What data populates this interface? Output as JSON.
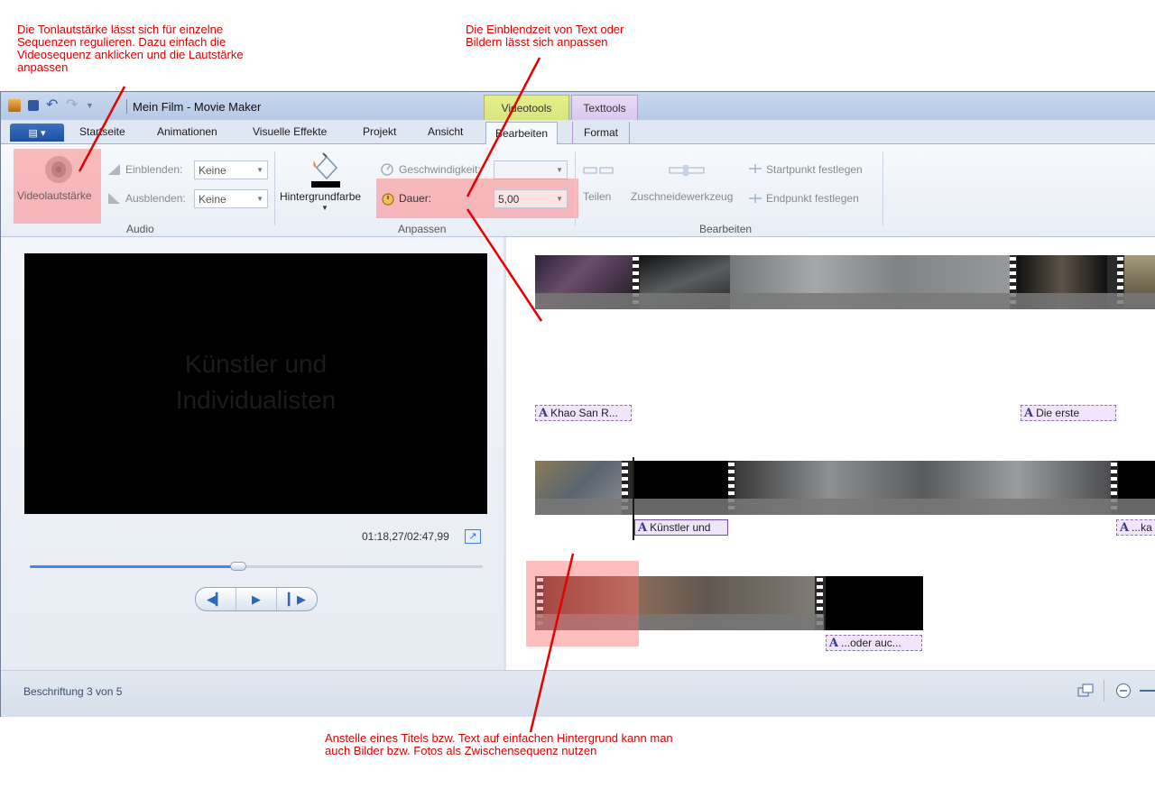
{
  "annotations": {
    "audio_note": "Die Tonlautstärke lässt sich für einzelne\nSequenzen regulieren. Dazu einfach die\nVideosequenz anklicken und die Lautstärke\nanpassen",
    "duration_note": "Die Einblendzeit von Text oder\nBildern lässt sich anpassen",
    "image_note": "Anstelle eines Titels bzw. Text auf einfachen Hintergrund kann man\nauch Bilder bzw. Fotos als Zwischensequenz nutzen"
  },
  "window": {
    "title": "Mein Film - Movie Maker",
    "context_tabs": {
      "video": "Videotools",
      "text": "Texttools"
    }
  },
  "tabs": [
    "Startseite",
    "Animationen",
    "Visuelle Effekte",
    "Projekt",
    "Ansicht",
    "Bearbeiten",
    "Format"
  ],
  "ribbon": {
    "audio": {
      "group": "Audio",
      "volume_label": "Videolautstärke",
      "fade_in_label": "Einblenden:",
      "fade_in_value": "Keine",
      "fade_out_label": "Ausblenden:",
      "fade_out_value": "Keine"
    },
    "adjust": {
      "group": "Anpassen",
      "background_color_label": "Hintergrundfarbe",
      "speed_label": "Geschwindigkeit:",
      "speed_value": "",
      "duration_label": "Dauer:",
      "duration_value": "5,00"
    },
    "edit": {
      "group": "Bearbeiten",
      "split_label": "Teilen",
      "trim_label": "Zuschneidewerkzeug",
      "start_label": "Startpunkt festlegen",
      "end_label": "Endpunkt festlegen"
    }
  },
  "preview": {
    "ghost_text": "Künstler und\nIndividualisten",
    "timecode": "01:18,27/02:47,99",
    "progress": 0.46
  },
  "timeline": {
    "captions": [
      "Khao San R...",
      "Die erste",
      "Künstler und",
      "...ka",
      "...oder auc..."
    ]
  },
  "status": {
    "text": "Beschriftung 3 von 5"
  },
  "colors": {
    "annotation": "#e00000",
    "highlight": "rgba(255,110,110,0.45)",
    "caption_bg": "#f1e4fb"
  }
}
